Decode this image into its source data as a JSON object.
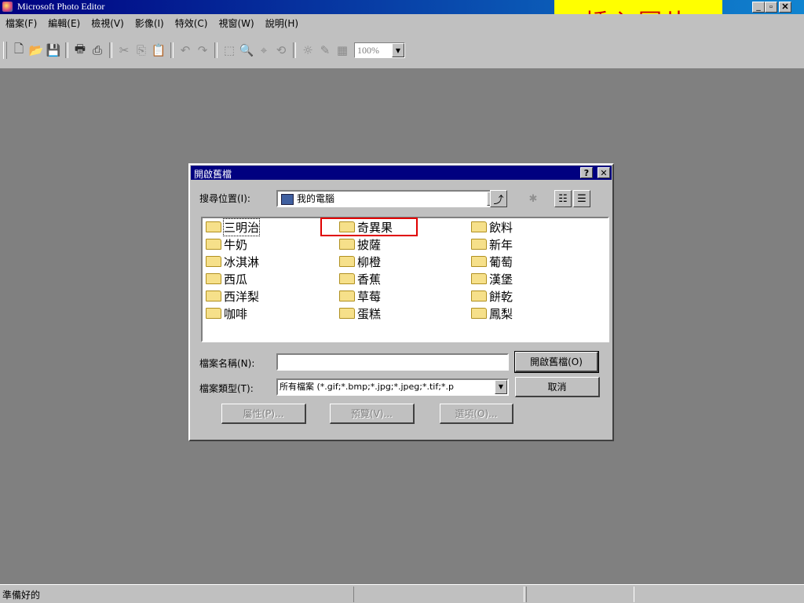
{
  "window": {
    "title": "Microsoft Photo Editor",
    "minimize": "_",
    "maximize": "▫",
    "close": "✕"
  },
  "caption_banner": "插入圖片",
  "menu": {
    "items": [
      "檔案(F)",
      "編輯(E)",
      "檢視(V)",
      "影像(I)",
      "特效(C)",
      "視窗(W)",
      "說明(H)"
    ]
  },
  "toolbar": {
    "zoom": "100%"
  },
  "dialog": {
    "title": "開啟舊檔",
    "help": "?",
    "close": "✕",
    "look_in_label": "搜尋位置(I):",
    "look_in_value": "我的電腦",
    "files": [
      "三明治",
      "牛奶",
      "冰淇淋",
      "西瓜",
      "西洋梨",
      "咖啡",
      "奇異果",
      "披薩",
      "柳橙",
      "香蕉",
      "草莓",
      "蛋糕",
      "飲料",
      "新年",
      "葡萄",
      "漢堡",
      "餅乾",
      "鳳梨"
    ],
    "filename_label": "檔案名稱(N):",
    "filename_value": "",
    "filetype_label": "檔案類型(T):",
    "filetype_value": "所有檔案 (*.gif;*.bmp;*.jpg;*.jpeg;*.tif;*.p",
    "open_button": "開啟舊檔(O)",
    "cancel_button": "取消",
    "properties_button": "屬性(P)...",
    "preview_button": "預覽(V)...",
    "options_button": "選項(O)..."
  },
  "status": {
    "text": "準備好的"
  }
}
